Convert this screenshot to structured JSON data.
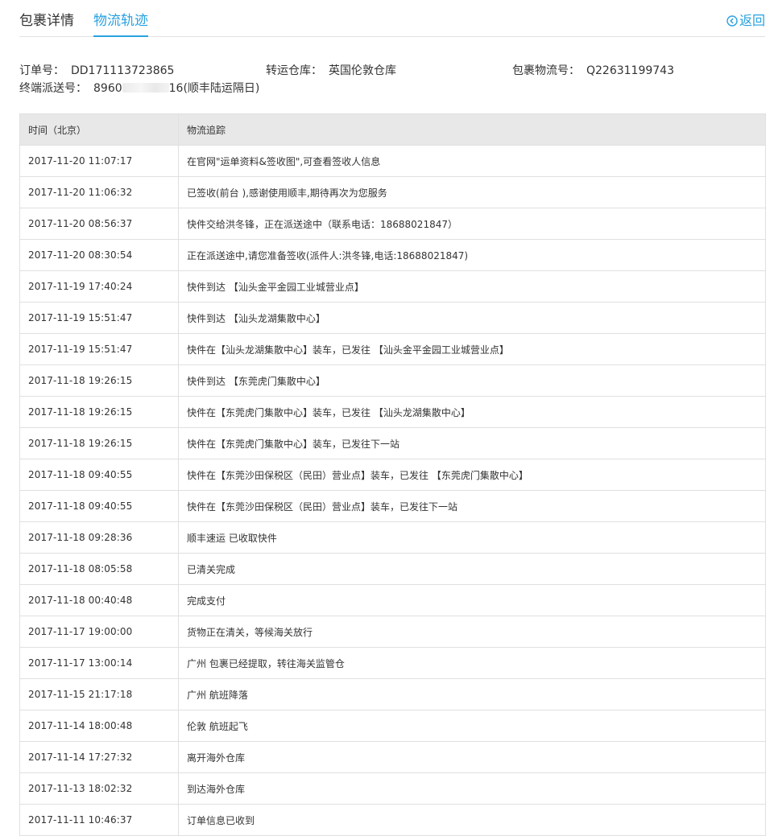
{
  "tabs": {
    "details": "包裹详情",
    "tracking": "物流轨迹",
    "back": "返回",
    "back_icon": "circle-arrow-left-icon"
  },
  "info": {
    "order_label": "订单号：",
    "order_value": "DD171113723865",
    "warehouse_label": "转运仓库：",
    "warehouse_value": "英国伦敦仓库",
    "parcel_label": "包裹物流号：",
    "parcel_value": "Q22631199743",
    "dispatch_label": "终端派送号：",
    "dispatch_prefix": "8960",
    "dispatch_suffix": "16(顺丰陆运隔日)"
  },
  "table": {
    "headers": [
      "时间（北京）",
      "物流追踪"
    ],
    "rows": [
      {
        "time": "2017-11-20 11:07:17",
        "event": "在官网\"运单资料&签收图\",可查看签收人信息"
      },
      {
        "time": "2017-11-20 11:06:32",
        "event": "已签收(前台 ),感谢使用顺丰,期待再次为您服务"
      },
      {
        "time": "2017-11-20 08:56:37",
        "event": "快件交给洪冬锋，正在派送途中（联系电话：18688021847）"
      },
      {
        "time": "2017-11-20 08:30:54",
        "event": "正在派送途中,请您准备签收(派件人:洪冬锋,电话:18688021847)"
      },
      {
        "time": "2017-11-19 17:40:24",
        "event": "快件到达 【汕头金平金园工业城营业点】"
      },
      {
        "time": "2017-11-19 15:51:47",
        "event": "快件到达 【汕头龙湖集散中心】"
      },
      {
        "time": "2017-11-19 15:51:47",
        "event": "快件在【汕头龙湖集散中心】装车，已发往 【汕头金平金园工业城营业点】"
      },
      {
        "time": "2017-11-18 19:26:15",
        "event": "快件到达 【东莞虎门集散中心】"
      },
      {
        "time": "2017-11-18 19:26:15",
        "event": "快件在【东莞虎门集散中心】装车，已发往 【汕头龙湖集散中心】"
      },
      {
        "time": "2017-11-18 19:26:15",
        "event": "快件在【东莞虎门集散中心】装车，已发往下一站"
      },
      {
        "time": "2017-11-18 09:40:55",
        "event": "快件在【东莞沙田保税区（民田）营业点】装车，已发往 【东莞虎门集散中心】"
      },
      {
        "time": "2017-11-18 09:40:55",
        "event": "快件在【东莞沙田保税区（民田）营业点】装车，已发往下一站"
      },
      {
        "time": "2017-11-18 09:28:36",
        "event": "顺丰速运 已收取快件"
      },
      {
        "time": "2017-11-18 08:05:58",
        "event": "已清关完成"
      },
      {
        "time": "2017-11-18 00:40:48",
        "event": "完成支付"
      },
      {
        "time": "2017-11-17 19:00:00",
        "event": "货物正在清关，等候海关放行"
      },
      {
        "time": "2017-11-17 13:00:14",
        "event": "广州 包裹已经提取，转往海关监管仓"
      },
      {
        "time": "2017-11-15 21:17:18",
        "event": "广州 航班降落"
      },
      {
        "time": "2017-11-14 18:00:48",
        "event": "伦敦 航班起飞"
      },
      {
        "time": "2017-11-14 17:27:32",
        "event": "离开海外仓库"
      },
      {
        "time": "2017-11-13 18:02:32",
        "event": "到达海外仓库"
      },
      {
        "time": "2017-11-11 10:46:37",
        "event": "订单信息已收到"
      }
    ]
  },
  "colors": {
    "accent": "#29a1e0",
    "header_bg": "#e8e8e8",
    "border": "#e0e0e0",
    "text": "#333333"
  }
}
